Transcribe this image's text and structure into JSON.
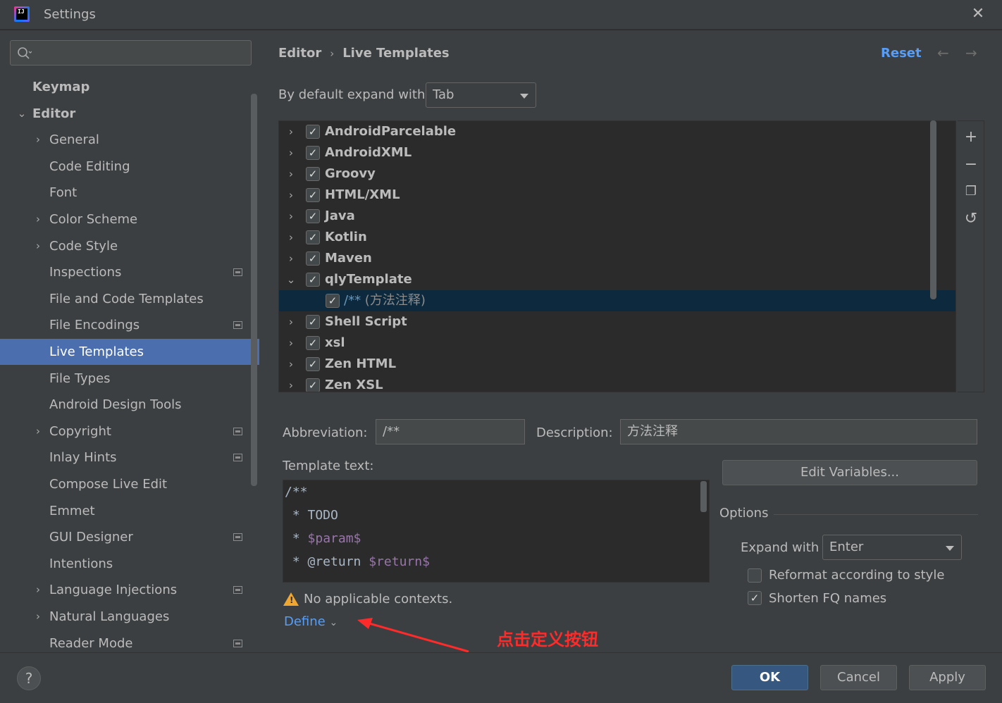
{
  "window": {
    "title": "Settings",
    "app_icon_text": "IJ"
  },
  "sidebar": {
    "search_value": "",
    "items": [
      {
        "label": "Keymap",
        "level": 0,
        "bold": true,
        "chevron": "",
        "project_icon": false,
        "selected": false
      },
      {
        "label": "Editor",
        "level": 0,
        "bold": true,
        "chevron": "⌄",
        "project_icon": false,
        "selected": false
      },
      {
        "label": "General",
        "level": 1,
        "bold": false,
        "chevron": "›",
        "project_icon": false,
        "selected": false
      },
      {
        "label": "Code Editing",
        "level": 1,
        "bold": false,
        "chevron": "",
        "project_icon": false,
        "selected": false
      },
      {
        "label": "Font",
        "level": 1,
        "bold": false,
        "chevron": "",
        "project_icon": false,
        "selected": false
      },
      {
        "label": "Color Scheme",
        "level": 1,
        "bold": false,
        "chevron": "›",
        "project_icon": false,
        "selected": false
      },
      {
        "label": "Code Style",
        "level": 1,
        "bold": false,
        "chevron": "›",
        "project_icon": false,
        "selected": false
      },
      {
        "label": "Inspections",
        "level": 1,
        "bold": false,
        "chevron": "",
        "project_icon": true,
        "selected": false
      },
      {
        "label": "File and Code Templates",
        "level": 1,
        "bold": false,
        "chevron": "",
        "project_icon": false,
        "selected": false
      },
      {
        "label": "File Encodings",
        "level": 1,
        "bold": false,
        "chevron": "",
        "project_icon": true,
        "selected": false
      },
      {
        "label": "Live Templates",
        "level": 1,
        "bold": false,
        "chevron": "",
        "project_icon": false,
        "selected": true
      },
      {
        "label": "File Types",
        "level": 1,
        "bold": false,
        "chevron": "",
        "project_icon": false,
        "selected": false
      },
      {
        "label": "Android Design Tools",
        "level": 1,
        "bold": false,
        "chevron": "",
        "project_icon": false,
        "selected": false
      },
      {
        "label": "Copyright",
        "level": 1,
        "bold": false,
        "chevron": "›",
        "project_icon": true,
        "selected": false
      },
      {
        "label": "Inlay Hints",
        "level": 1,
        "bold": false,
        "chevron": "",
        "project_icon": true,
        "selected": false
      },
      {
        "label": "Compose Live Edit",
        "level": 1,
        "bold": false,
        "chevron": "",
        "project_icon": false,
        "selected": false
      },
      {
        "label": "Emmet",
        "level": 1,
        "bold": false,
        "chevron": "",
        "project_icon": false,
        "selected": false
      },
      {
        "label": "GUI Designer",
        "level": 1,
        "bold": false,
        "chevron": "",
        "project_icon": true,
        "selected": false
      },
      {
        "label": "Intentions",
        "level": 1,
        "bold": false,
        "chevron": "",
        "project_icon": false,
        "selected": false
      },
      {
        "label": "Language Injections",
        "level": 1,
        "bold": false,
        "chevron": "›",
        "project_icon": true,
        "selected": false
      },
      {
        "label": "Natural Languages",
        "level": 1,
        "bold": false,
        "chevron": "›",
        "project_icon": false,
        "selected": false
      },
      {
        "label": "Reader Mode",
        "level": 1,
        "bold": false,
        "chevron": "",
        "project_icon": true,
        "selected": false
      }
    ]
  },
  "header": {
    "breadcrumb": [
      "Editor",
      "Live Templates"
    ],
    "separator": "›",
    "reset_label": "Reset",
    "back_icon": "←",
    "forward_icon": "→"
  },
  "expand_default": {
    "label": "By default expand with",
    "value": "Tab"
  },
  "template_groups": [
    {
      "label": "AndroidParcelable",
      "checked": true,
      "chevron": "›",
      "child": false,
      "selected": false
    },
    {
      "label": "AndroidXML",
      "checked": true,
      "chevron": "›",
      "child": false,
      "selected": false
    },
    {
      "label": "Groovy",
      "checked": true,
      "chevron": "›",
      "child": false,
      "selected": false
    },
    {
      "label": "HTML/XML",
      "checked": true,
      "chevron": "›",
      "child": false,
      "selected": false
    },
    {
      "label": "Java",
      "checked": true,
      "chevron": "›",
      "child": false,
      "selected": false
    },
    {
      "label": "Kotlin",
      "checked": true,
      "chevron": "›",
      "child": false,
      "selected": false
    },
    {
      "label": "Maven",
      "checked": true,
      "chevron": "›",
      "child": false,
      "selected": false
    },
    {
      "label": "qlyTemplate",
      "checked": true,
      "chevron": "⌄",
      "child": false,
      "selected": false
    },
    {
      "label": "/**",
      "desc": " (方法注释)",
      "checked": true,
      "chevron": "",
      "child": true,
      "selected": true
    },
    {
      "label": "Shell Script",
      "checked": true,
      "chevron": "›",
      "child": false,
      "selected": false
    },
    {
      "label": "xsl",
      "checked": true,
      "chevron": "›",
      "child": false,
      "selected": false
    },
    {
      "label": "Zen HTML",
      "checked": true,
      "chevron": "›",
      "child": false,
      "selected": false
    },
    {
      "label": "Zen XSL",
      "checked": true,
      "chevron": "›",
      "child": false,
      "selected": false
    }
  ],
  "tree_tools": {
    "add": "+",
    "remove": "−",
    "copy": "❐",
    "restore": "↺"
  },
  "form": {
    "abbreviation_label": "Abbreviation:",
    "abbreviation_value": "/**",
    "description_label": "Description:",
    "description_value": "方法注释",
    "template_text_label": "Template text:",
    "template_lines": [
      {
        "pre": "/**",
        "var": "",
        "post": ""
      },
      {
        "pre": " * TODO",
        "var": "",
        "post": ""
      },
      {
        "pre": " * ",
        "var": "$param$",
        "post": ""
      },
      {
        "pre": " * @return ",
        "var": "$return$",
        "post": ""
      }
    ],
    "edit_variables_label": "Edit Variables...",
    "options_title": "Options",
    "expand_with_label": "Expand with",
    "expand_with_value": "Enter",
    "reformat_label": "Reformat according to style",
    "reformat_checked": false,
    "shorten_label": "Shorten FQ names",
    "shorten_checked": true,
    "warning_text": "No applicable contexts.",
    "define_label": "Define",
    "define_chevron": "⌄"
  },
  "annotation": {
    "text": "点击定义按钮",
    "color": "#ff2a2a"
  },
  "footer": {
    "help_label": "?",
    "ok_label": "OK",
    "cancel_label": "Cancel",
    "apply_label": "Apply"
  },
  "colors": {
    "accent": "#4b6eaf",
    "link": "#589df6",
    "selection": "#0d293e",
    "primary_button": "#365880"
  }
}
